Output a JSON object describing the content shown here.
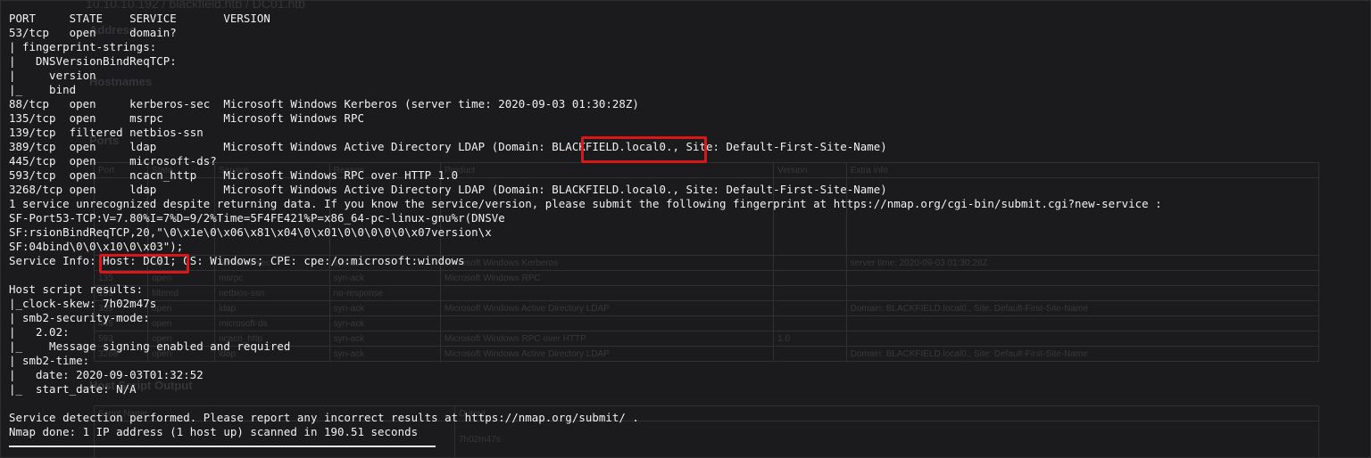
{
  "terminal": {
    "lines": [
      "PORT     STATE    SERVICE       VERSION",
      "53/tcp   open     domain?",
      "| fingerprint-strings:",
      "|   DNSVersionBindReqTCP:",
      "|     version",
      "|_    bind",
      "88/tcp   open     kerberos-sec  Microsoft Windows Kerberos (server time: 2020-09-03 01:30:28Z)",
      "135/tcp  open     msrpc         Microsoft Windows RPC",
      "139/tcp  filtered netbios-ssn",
      "389/tcp  open     ldap          Microsoft Windows Active Directory LDAP (Domain: BLACKFIELD.local0., Site: Default-First-Site-Name)",
      "445/tcp  open     microsoft-ds?",
      "593/tcp  open     ncacn_http    Microsoft Windows RPC over HTTP 1.0",
      "3268/tcp open     ldap          Microsoft Windows Active Directory LDAP (Domain: BLACKFIELD.local0., Site: Default-First-Site-Name)",
      "1 service unrecognized despite returning data. If you know the service/version, please submit the following fingerprint at https://nmap.org/cgi-bin/submit.cgi?new-service :",
      "SF-Port53-TCP:V=7.80%I=7%D=9/2%Time=5F4FE421%P=x86_64-pc-linux-gnu%r(DNSVe",
      "SF:rsionBindReqTCP,20,\"\\0\\x1e\\0\\x06\\x81\\x04\\0\\x01\\0\\0\\0\\0\\0\\x07version\\x",
      "SF:04bind\\0\\0\\x10\\0\\x03\");",
      "Service Info: Host: DC01; OS: Windows; CPE: cpe:/o:microsoft:windows",
      "",
      "Host script results:",
      "|_clock-skew: 7h02m47s",
      "| smb2-security-mode:",
      "|   2.02:",
      "|_    Message signing enabled and required",
      "| smb2-time:",
      "|   date: 2020-09-03T01:32:52",
      "|_  start_date: N/A",
      "",
      "Service detection performed. Please report any incorrect results at https://nmap.org/submit/ .",
      "Nmap done: 1 IP address (1 host up) scanned in 190.51 seconds"
    ]
  },
  "background_report": {
    "title": "10.10.10.192 / blackfield.htb / DC01.htb",
    "section_address": "Address",
    "section_hostnames": "Hostnames",
    "section_ports": "Ports",
    "section_script": "Host Script Output",
    "columns": [
      "Port",
      "State",
      "Service",
      "Reason",
      "Product",
      "Version",
      "Extra info"
    ],
    "rows": [
      [
        "",
        "",
        "",
        "",
        "",
        "",
        ""
      ],
      [
        "88",
        "tcp",
        "open",
        "kerberos-sec",
        "syn-ack",
        "Microsoft Windows Kerberos",
        "server time: 2020-09-03 01:30:28Z"
      ],
      [
        "135",
        "tcp",
        "open",
        "msrpc",
        "syn-ack",
        "Microsoft Windows RPC",
        ""
      ],
      [
        "139",
        "tcp",
        "filtered",
        "netbios-ssn",
        "no-response",
        "",
        ""
      ],
      [
        "389",
        "tcp",
        "open",
        "ldap",
        "syn-ack",
        "Microsoft Windows Active Directory LDAP",
        "Domain: BLACKFIELD.local0., Site: Default-First-Site-Name"
      ],
      [
        "445",
        "tcp",
        "open",
        "microsoft-ds",
        "syn-ack",
        "",
        ""
      ],
      [
        "593",
        "tcp",
        "open",
        "ncacn_http",
        "syn-ack",
        "Microsoft Windows RPC over HTTP",
        "1.0"
      ],
      [
        "3268",
        "tcp",
        "open",
        "ldap",
        "syn-ack",
        "Microsoft Windows Active Directory LDAP",
        "Domain: BLACKFIELD.local0., Site: Default-First-Site-Name"
      ]
    ],
    "script_columns": [
      "Script Name",
      "Output"
    ],
    "script_value": "7h02m47s"
  },
  "colors": {
    "background": "#1b1b1d",
    "text": "#f2f2f2",
    "highlight": "#d8161b"
  }
}
